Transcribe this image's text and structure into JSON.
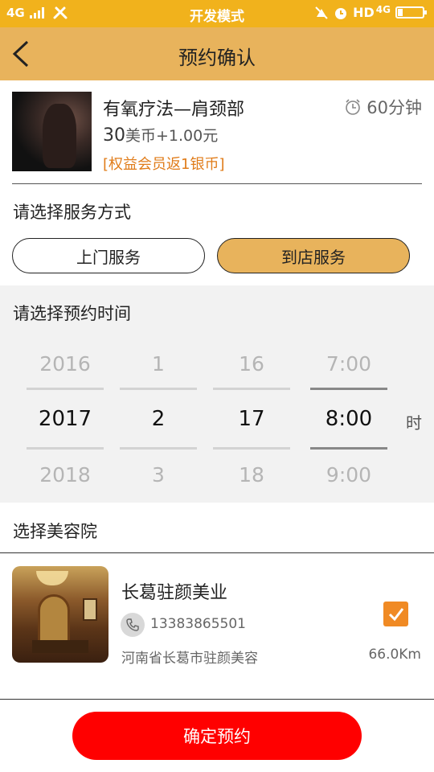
{
  "status_bar": {
    "network": "4G",
    "center_text": "开发模式",
    "right_text": "HD",
    "right_network": "4G"
  },
  "nav": {
    "title": "预约确认",
    "back_icon": "chevron-left-icon"
  },
  "product": {
    "name": "有氧疗法—肩颈部",
    "price_main": "30",
    "price_unit": "美币+1.00元",
    "rebate": "[权益会员返1银币]",
    "duration": "60分钟"
  },
  "service": {
    "label": "请选择服务方式",
    "options": [
      "上门服务",
      "到店服务"
    ],
    "selected": "到店服务"
  },
  "time": {
    "label": "请选择预约时间",
    "years": [
      "2016",
      "2017",
      "2018"
    ],
    "months": [
      "1",
      "2",
      "3"
    ],
    "days": [
      "16",
      "17",
      "18"
    ],
    "hours": [
      "7:00",
      "8:00",
      "9:00"
    ],
    "hour_unit": "时"
  },
  "salon_section": {
    "label": "选择美容院",
    "salon": {
      "name": "长葛驻颜美业",
      "phone": "13383865501",
      "address": "河南省长葛市驻颜美容",
      "distance": "66.0Km",
      "checked": true
    }
  },
  "confirm_button": "确定预约",
  "colors": {
    "status_bar": "#f1b21c",
    "nav_bar": "#e8b35c",
    "accent_orange": "#f08a24",
    "rebate_text": "#e07c1a",
    "confirm_red": "#ff0000"
  }
}
